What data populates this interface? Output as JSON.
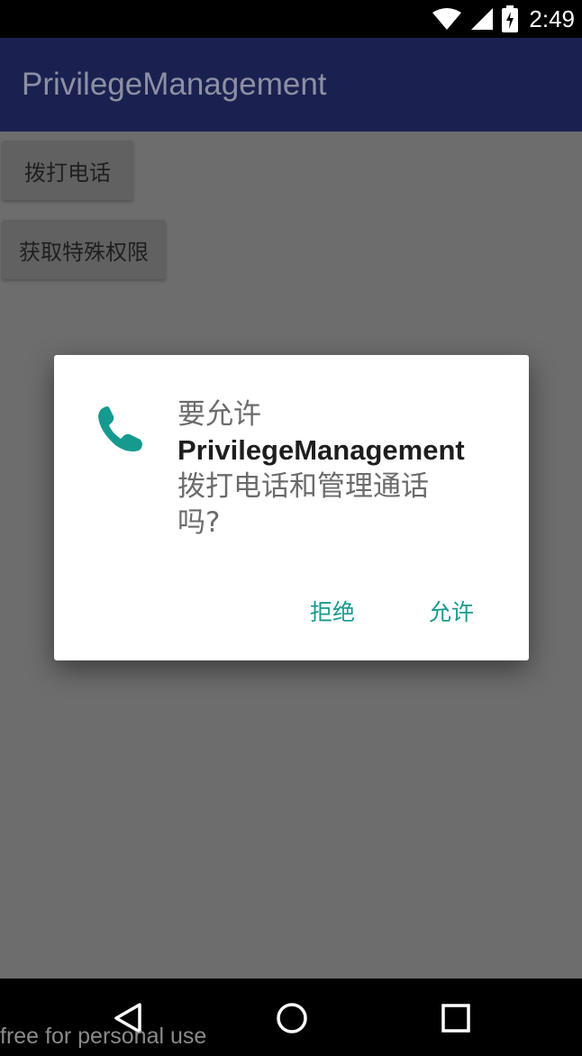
{
  "status_bar": {
    "time": "2:49",
    "icons": [
      "wifi-icon",
      "cell-signal-icon",
      "battery-charging-icon"
    ]
  },
  "app_bar": {
    "title": "PrivilegeManagement"
  },
  "buttons": {
    "call": "拨打电话",
    "get_permission": "获取特殊权限"
  },
  "dialog": {
    "line1": "要允许",
    "app_name": "PrivilegeManagement",
    "line2": "拨打电话和管理通话",
    "line3": "吗?",
    "deny": "拒绝",
    "allow": "允许",
    "icon": "phone-icon"
  },
  "nav_bar": {
    "icons": [
      "back-icon",
      "home-icon",
      "recents-icon"
    ]
  },
  "watermark": "free for personal use",
  "colors": {
    "app_bar": "#1a2150",
    "accent": "#169a8f",
    "scrim": "#6d6d6d"
  }
}
